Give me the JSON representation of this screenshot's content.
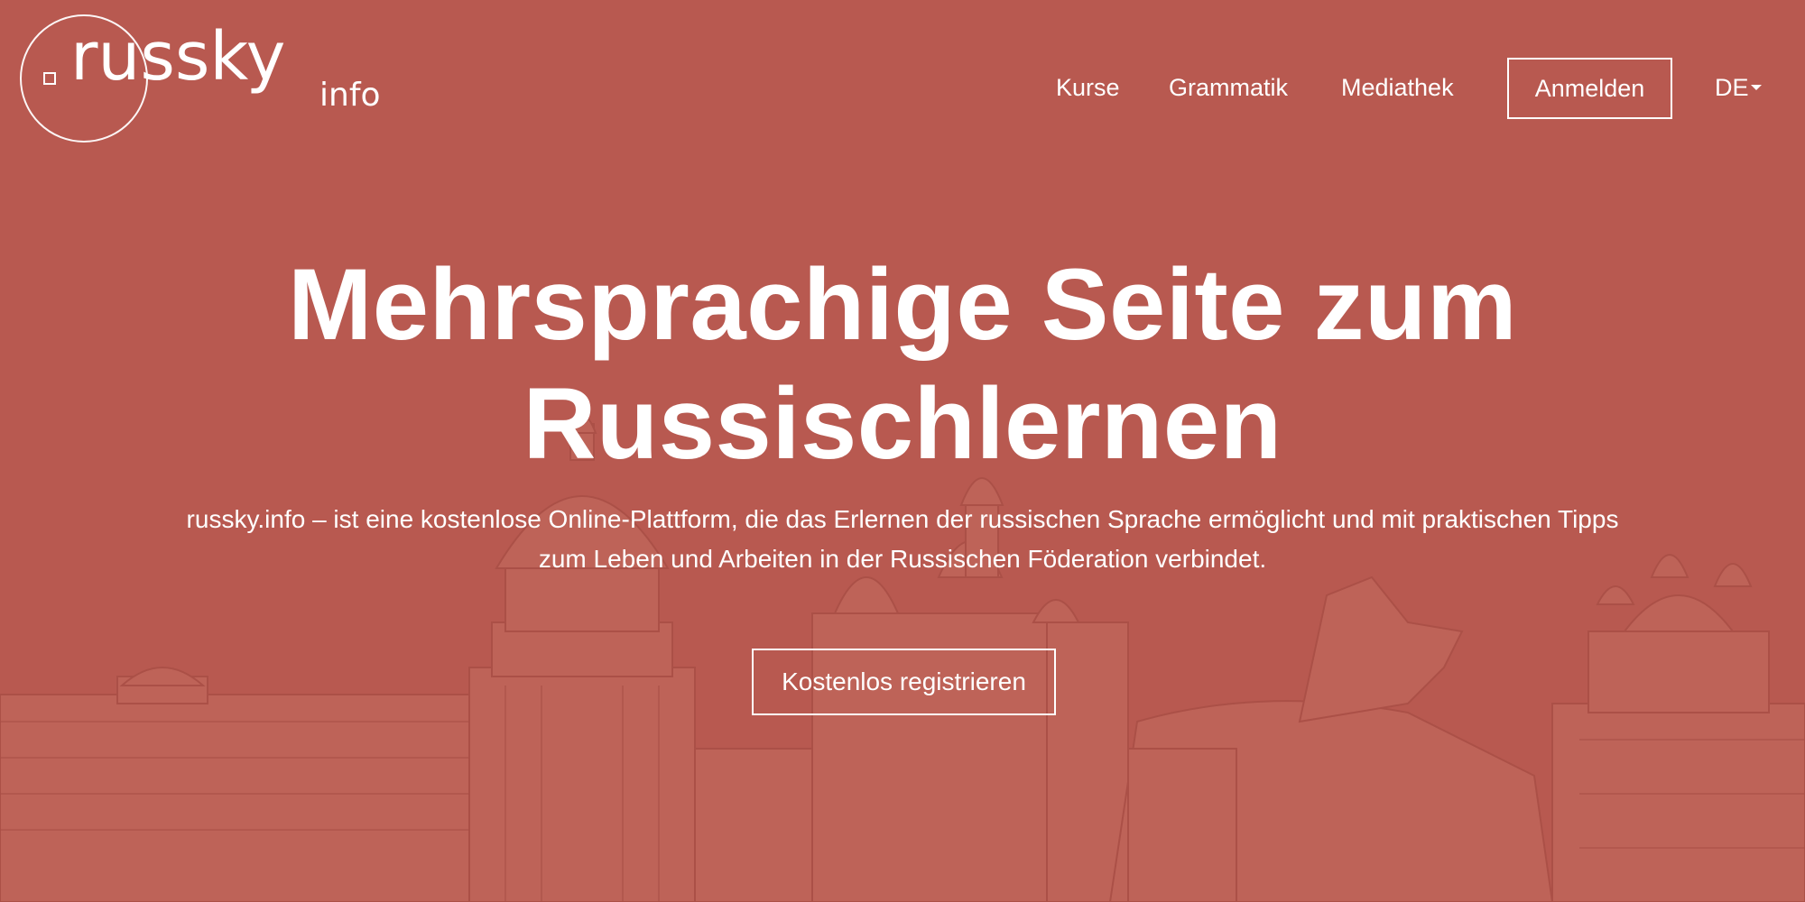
{
  "logo": {
    "main": "russky",
    "sub": "info"
  },
  "nav": {
    "items": [
      {
        "label": "Kurse"
      },
      {
        "label": "Grammatik"
      },
      {
        "label": "Mediathek"
      }
    ],
    "login_label": "Anmelden",
    "language": "DE"
  },
  "hero": {
    "headline_line1": "Mehrsprachige Seite zum",
    "headline_line2": "Russischlernen",
    "subtitle_line1": "russky.info – ist eine kostenlose Online-Plattform, die das Erlernen der russischen Sprache ermöglicht und mit praktischen Tipps",
    "subtitle_line2": "zum Leben und Arbeiten in der Russischen Föderation verbindet.",
    "cta_label": "Kostenlos registrieren"
  },
  "colors": {
    "background": "#b85a50",
    "text": "#ffffff",
    "skyline_stroke": "#9c4238",
    "skyline_fill": "#c06a5e"
  },
  "icons": {
    "language_dropdown": "caret-down-icon"
  }
}
